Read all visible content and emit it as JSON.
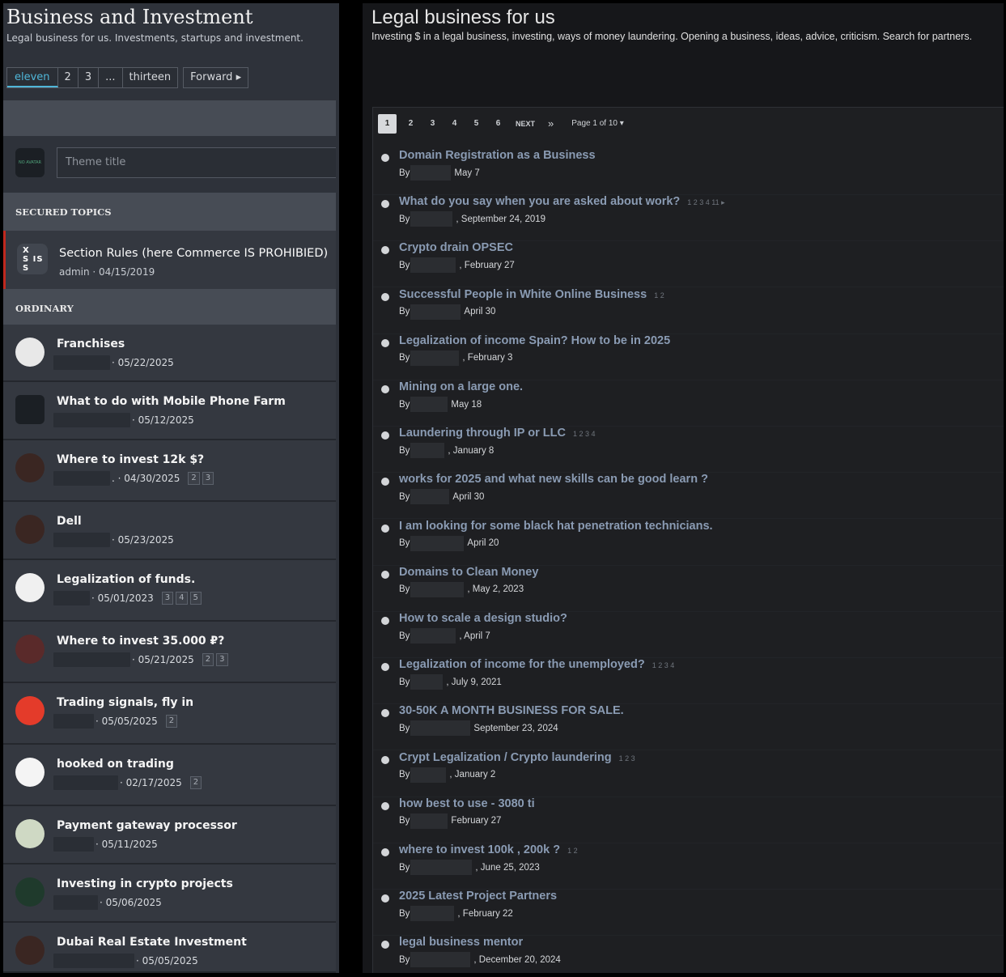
{
  "left": {
    "title": "Business and Investment",
    "subtitle": "Legal business for us. Investments, startups and investment.",
    "pager": {
      "pages": [
        "eleven",
        "2",
        "3",
        "...",
        "thirteen"
      ],
      "forward": "Forward ▸"
    },
    "new_topic": {
      "avatar_text": "NO AVATAR",
      "placeholder": "Theme title"
    },
    "secured_header": "SECURED TOPICS",
    "pinned": {
      "title": "Section Rules (here Commerce IS PROHIBIED)",
      "meta": "admin · 04/15/2019",
      "avatar_text": "X S IS S"
    },
    "ordinary_header": "ORDINARY",
    "topics": [
      {
        "title": "Franchises",
        "date": "· 05/22/2025",
        "pages": [],
        "avatar": "skull-avatar"
      },
      {
        "title": "What to do with Mobile Phone Farm",
        "date": "· 05/12/2025",
        "pages": [],
        "avatar": "no-avatar"
      },
      {
        "title": "Where to invest 12k $?",
        "date": ". · 04/30/2025",
        "pages": [
          "2",
          "3"
        ],
        "avatar": "person-avatar"
      },
      {
        "title": "Dell",
        "date": "· 05/23/2025",
        "pages": [],
        "avatar": "person-avatar"
      },
      {
        "title": "Legalization of funds.",
        "date": "· 05/01/2023",
        "pages": [
          "3",
          "4",
          "5"
        ],
        "avatar": "emblem-avatar"
      },
      {
        "title": "Where to invest 35.000 ₽?",
        "date": "· 05/21/2025",
        "pages": [
          "2",
          "3"
        ],
        "avatar": "red-lines-avatar"
      },
      {
        "title": "Trading signals, fly in",
        "date": "· 05/05/2025",
        "pages": [
          "2"
        ],
        "avatar": "bang-avatar"
      },
      {
        "title": "hooked on trading",
        "date": "· 02/17/2025",
        "pages": [
          "2"
        ],
        "avatar": "dog-avatar"
      },
      {
        "title": "Payment gateway processor",
        "date": "· 05/11/2025",
        "pages": [],
        "avatar": "cartoon-avatar"
      },
      {
        "title": "Investing in crypto projects",
        "date": "· 05/06/2025",
        "pages": [],
        "avatar": "logo-avatar"
      },
      {
        "title": "Dubai Real Estate Investment",
        "date": "· 05/05/2025",
        "pages": [],
        "avatar": "person-avatar"
      }
    ]
  },
  "right": {
    "title": "Legal business for us",
    "description": "Investing $ in a legal business, investing, ways of money laundering. Opening a business, ideas, advice, criticism. Search for partners.",
    "pager": {
      "pages": [
        "1",
        "2",
        "3",
        "4",
        "5",
        "6"
      ],
      "next": "NEXT",
      "last": "»",
      "page_of": "Page 1 of 10 ▾"
    },
    "threads": [
      {
        "title": "Domain Registration as a Business",
        "by": "By",
        "date": "May 7",
        "pages": ""
      },
      {
        "title": "What do you say when you are asked about work?",
        "by": "By",
        "date": ", September 24, 2019",
        "pages": "1   2   3   4   11 ▸"
      },
      {
        "title": "Crypto drain OPSEC",
        "by": "By",
        "date": ", February 27",
        "pages": ""
      },
      {
        "title": "Successful People in White Online Business",
        "by": "By",
        "date": "April 30",
        "pages": "1   2"
      },
      {
        "title": "Legalization of income Spain? How to be in 2025",
        "by": "By",
        "date": ", February 3",
        "pages": ""
      },
      {
        "title": "Mining on a large one.",
        "by": "By",
        "date": "May 18",
        "pages": ""
      },
      {
        "title": "Laundering through IP or LLC",
        "by": "By",
        "date": ", January 8",
        "pages": "1   2   3   4"
      },
      {
        "title": "works for 2025 and what new skills can be good learn ?",
        "by": "By",
        "date": "April 30",
        "pages": ""
      },
      {
        "title": "I am looking for some black hat penetration technicians.",
        "by": "By",
        "date": "April 20",
        "pages": ""
      },
      {
        "title": "Domains to Clean Money",
        "by": "By",
        "date": ", May 2, 2023",
        "pages": ""
      },
      {
        "title": "How to scale a design studio?",
        "by": "By",
        "date": ", April 7",
        "pages": ""
      },
      {
        "title": "Legalization of income for the unemployed?",
        "by": "By",
        "date": ", July 9, 2021",
        "pages": "1   2   3   4"
      },
      {
        "title": "30-50K A MONTH BUSINESS FOR SALE.",
        "by": "By",
        "date": "September 23, 2024",
        "pages": ""
      },
      {
        "title": "Crypt Legalization / Crypto laundering",
        "by": "By",
        "date": ", January 2",
        "pages": "1   2   3"
      },
      {
        "title": "how best to use - 3080 ti",
        "by": "By",
        "date": "February 27",
        "pages": ""
      },
      {
        "title": "where to invest 100k , 200k ?",
        "by": "By",
        "date": ", June 25, 2023",
        "pages": "1   2"
      },
      {
        "title": "2025 Latest Project Partners",
        "by": "By",
        "date": ", February 22",
        "pages": ""
      },
      {
        "title": "legal business mentor",
        "by": "By",
        "date": ", December 20, 2024",
        "pages": ""
      }
    ]
  }
}
